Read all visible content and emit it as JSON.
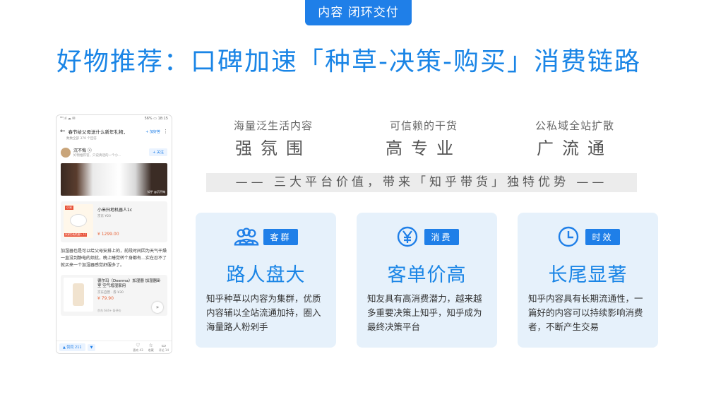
{
  "top_tag": "内容 闭环交付",
  "title": "好物推荐：口碑加速「种草-决策-购买」消费链路",
  "phone": {
    "status_left": "ᴴᴰ.ıl ☁ ✉",
    "status_right": "56% ▭ 18:15",
    "question_title": "春节给父母送什么新年礼物，",
    "question_sub": "数数全部 370 个回答",
    "follow_question": "+ 加好答",
    "author_name": "沉不悔 ⓥ",
    "author_desc": "好物推荐官，只说真话的一个小…",
    "follow_label": "+ 关注",
    "image_caption": "知乎 @沉不悔",
    "product1": {
      "badge": "小米",
      "thumb_foot": "米家扫地机器人 1C",
      "name": "小米扫地机器人1c",
      "meta": "京东 ¥20",
      "price": "¥ 1299.00"
    },
    "paragraph": "加湿器也是可以给父母安排上的，前段时间因为天气干燥一直没到静电的烦扰，晚上睡觉转个身都有…实在忍不了就买来一个加湿器感觉舒服多了。",
    "product2": {
      "name": "德尔玛（Deerma）加湿器 加湿器卧室 空气增湿家用",
      "meta": "京东自营 · 券 ¥30",
      "price": "¥ 79.90",
      "rating": "京东 644+ 条评价"
    },
    "vote_label": "▲ 赞同 211",
    "down_label": "▼",
    "actions": [
      {
        "icon": "♡",
        "label": "喜欢 43"
      },
      {
        "icon": "☆",
        "label": "收藏"
      },
      {
        "icon": "▭",
        "label": "评论 14"
      }
    ]
  },
  "values": [
    {
      "sub": "海量泛生活内容",
      "main": "强氛围"
    },
    {
      "sub": "可信赖的干货",
      "main": "高专业"
    },
    {
      "sub": "公私域全站扩散",
      "main": "广流通"
    }
  ],
  "banner": "——  三大平台价值，带来「知乎带货」独特优势  ——",
  "cards": [
    {
      "icon": "users-icon",
      "tag": "客群",
      "title": "路人盘大",
      "desc": "知乎种草以内容为集群，优质内容辅以全站流通加持，圈入海量路人粉剁手"
    },
    {
      "icon": "yen-icon",
      "tag": "消费",
      "title": "客单价高",
      "desc": "知友具有高消费潜力，越来越多重要决策上知乎，知乎成为最终决策平台"
    },
    {
      "icon": "clock-icon",
      "tag": "时效",
      "title": "长尾显著",
      "desc": "知乎内容具有长期流通性，一篇好的内容可以持续影响消费者，不断产生交易"
    }
  ],
  "colors": {
    "accent": "#1f7fe8",
    "title": "#1a85e6",
    "card_bg": "#e6f1fb"
  }
}
